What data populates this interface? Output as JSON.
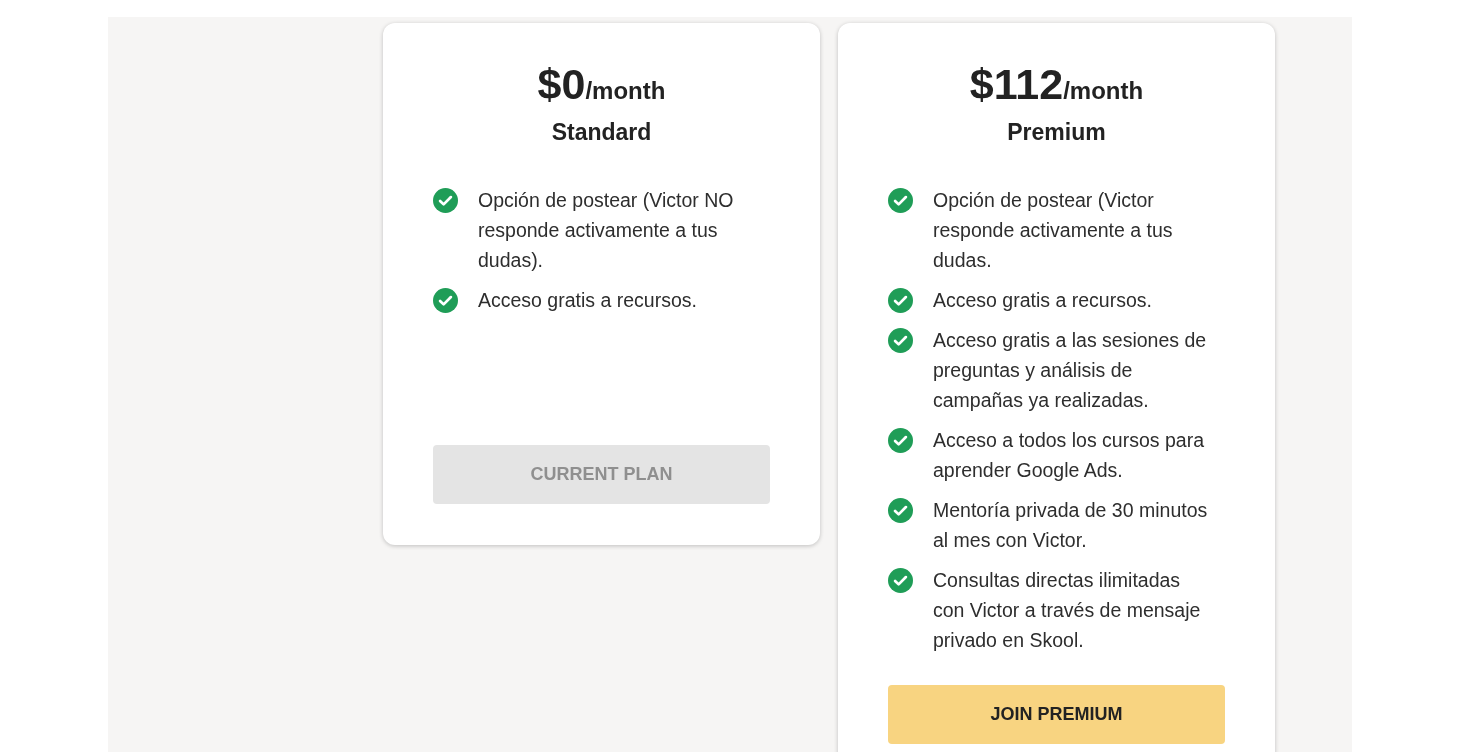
{
  "plans": [
    {
      "price": "$0",
      "period": "/month",
      "name": "Standard",
      "features": [
        "Opción de postear (Victor NO responde activamente a tus dudas).",
        "Acceso gratis a recursos."
      ],
      "button": {
        "label": "CURRENT PLAN",
        "disabled": true
      }
    },
    {
      "price": "$112",
      "period": "/month",
      "name": "Premium",
      "features": [
        "Opción de postear (Victor responde activamente a tus dudas.",
        "Acceso gratis a recursos.",
        "Acceso gratis a las sesiones de preguntas y análisis de campañas ya realizadas.",
        "Acceso a todos los cursos para aprender Google Ads.",
        "Mentoría privada de 30 minutos al mes con Victor.",
        "Consultas directas ilimitadas con Victor a través de mensaje privado en Skool."
      ],
      "button": {
        "label": "JOIN PREMIUM",
        "disabled": false
      }
    }
  ]
}
